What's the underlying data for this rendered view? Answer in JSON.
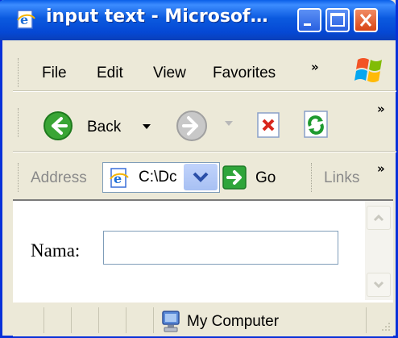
{
  "window": {
    "title": "input text - Microsof…",
    "icon": "ie-page-icon",
    "controls": [
      "minimize",
      "maximize",
      "close"
    ]
  },
  "menubar": {
    "items": [
      "File",
      "Edit",
      "View",
      "Favorites"
    ],
    "overflow": "»"
  },
  "toolbar": {
    "back_label": "Back",
    "overflow": "»"
  },
  "addressbar": {
    "label": "Address",
    "value": "C:\\Dc",
    "go_label": "Go",
    "links_label": "Links",
    "overflow": "»"
  },
  "form": {
    "label": "Nama:",
    "input_value": ""
  },
  "statusbar": {
    "zone_text": "My Computer"
  },
  "colors": {
    "titlebar": "#0a5fe8",
    "frame": "#ece9d8",
    "close_button": "#d84516"
  }
}
